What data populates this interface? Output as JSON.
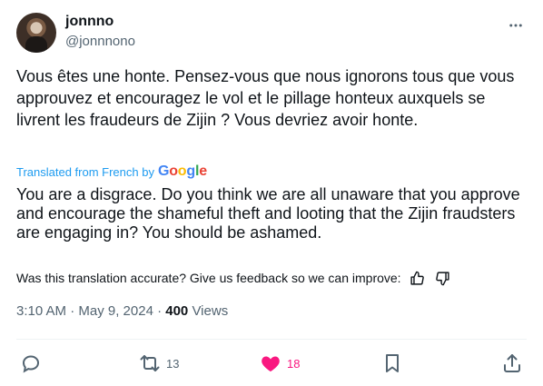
{
  "tweet": {
    "author_name": "jonnno",
    "author_handle": "@jonnnono",
    "original_text": "Vous êtes une honte. Pensez-vous que nous ignorons tous que vous approuvez et encouragez le vol et le pillage honteux auxquels se livrent les fraudeurs de Zijin ? Vous devriez avoir honte.",
    "translated_from": "Translated from French by",
    "translated_text": "You are a disgrace. Do you think we are all unaware that you approve and encourage the shameful theft and looting that the Zijin fraudsters are engaging in? You should be ashamed.",
    "feedback_prompt": "Was this translation accurate? Give us feedback so we can improve:",
    "timestamp": "3:10 AM · May 9, 2024 · ",
    "views_count": "400",
    "views_label": " Views"
  },
  "actions": {
    "retweets": "13",
    "likes": "18"
  },
  "colors": {
    "accent": "#1d9bf0",
    "like": "#f91880",
    "muted": "#536471"
  },
  "icons": [
    "more-icon",
    "thumbs-up-icon",
    "thumbs-down-icon",
    "reply-icon",
    "retweet-icon",
    "heart-icon",
    "bookmark-icon",
    "share-icon"
  ]
}
